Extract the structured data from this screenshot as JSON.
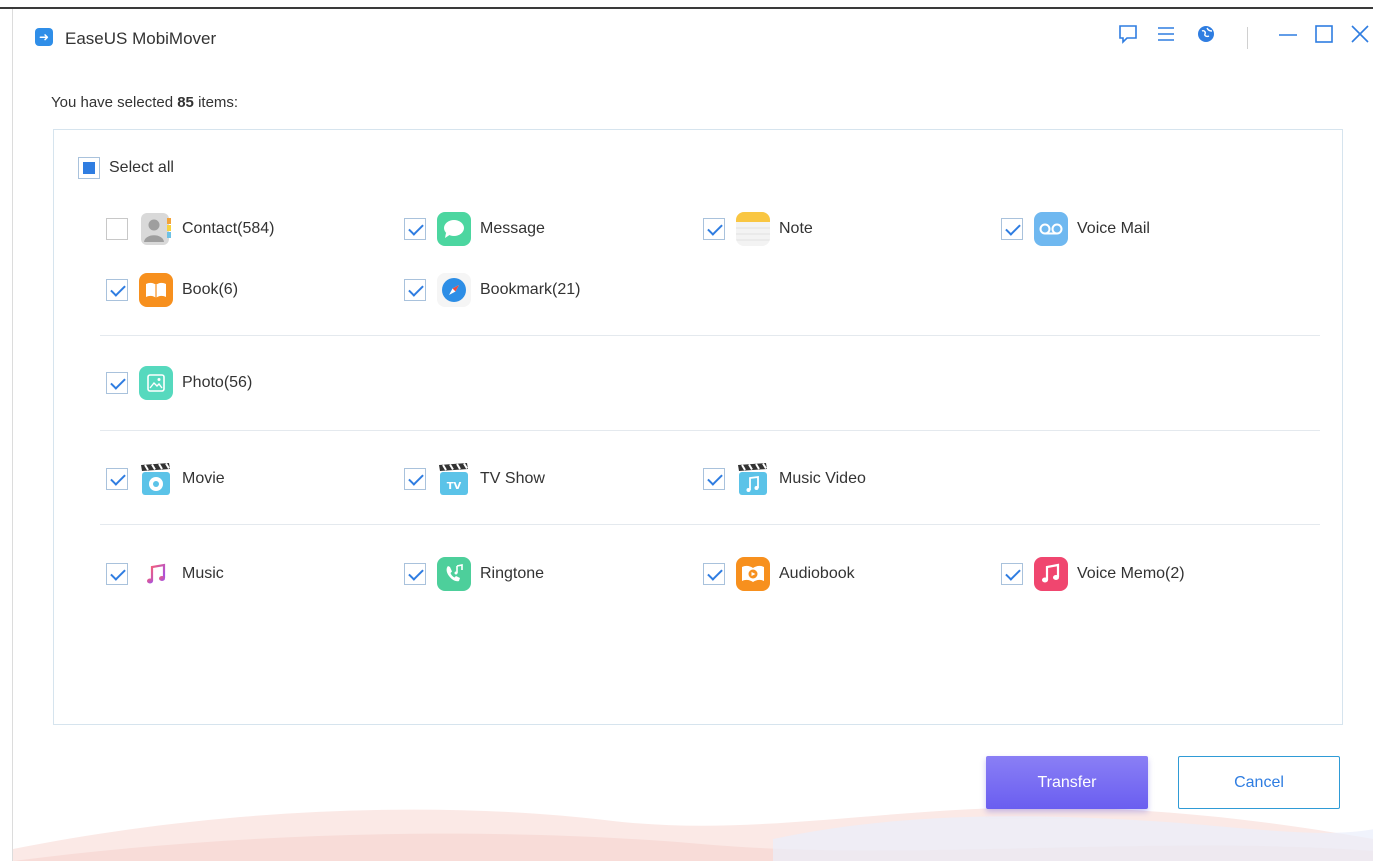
{
  "app": {
    "title": "EaseUS MobiMover"
  },
  "summary": {
    "prefix": "You have selected ",
    "count": "85",
    "suffix": " items:"
  },
  "select_all": {
    "label": "Select all",
    "state": "partial"
  },
  "items": [
    {
      "label": "Contact(584)",
      "checked": false,
      "icon": "contact-icon"
    },
    {
      "label": "Message",
      "checked": true,
      "icon": "message-icon"
    },
    {
      "label": "Note",
      "checked": true,
      "icon": "note-icon"
    },
    {
      "label": "Voice Mail",
      "checked": true,
      "icon": "voicemail-icon"
    },
    {
      "label": "Book(6)",
      "checked": true,
      "icon": "book-icon"
    },
    {
      "label": "Bookmark(21)",
      "checked": true,
      "icon": "bookmark-icon"
    },
    {
      "label": "Photo(56)",
      "checked": true,
      "icon": "photo-icon"
    },
    {
      "label": "Movie",
      "checked": true,
      "icon": "movie-icon"
    },
    {
      "label": "TV Show",
      "checked": true,
      "icon": "tv-show-icon"
    },
    {
      "label": "Music Video",
      "checked": true,
      "icon": "music-video-icon"
    },
    {
      "label": "Music",
      "checked": true,
      "icon": "music-icon"
    },
    {
      "label": "Ringtone",
      "checked": true,
      "icon": "ringtone-icon"
    },
    {
      "label": "Audiobook",
      "checked": true,
      "icon": "audiobook-icon"
    },
    {
      "label": "Voice Memo(2)",
      "checked": true,
      "icon": "voice-memo-icon"
    }
  ],
  "buttons": {
    "transfer": "Transfer",
    "cancel": "Cancel"
  },
  "colors": {
    "accent": "#2f7de1",
    "transfer_button": "#7b6cf0"
  }
}
